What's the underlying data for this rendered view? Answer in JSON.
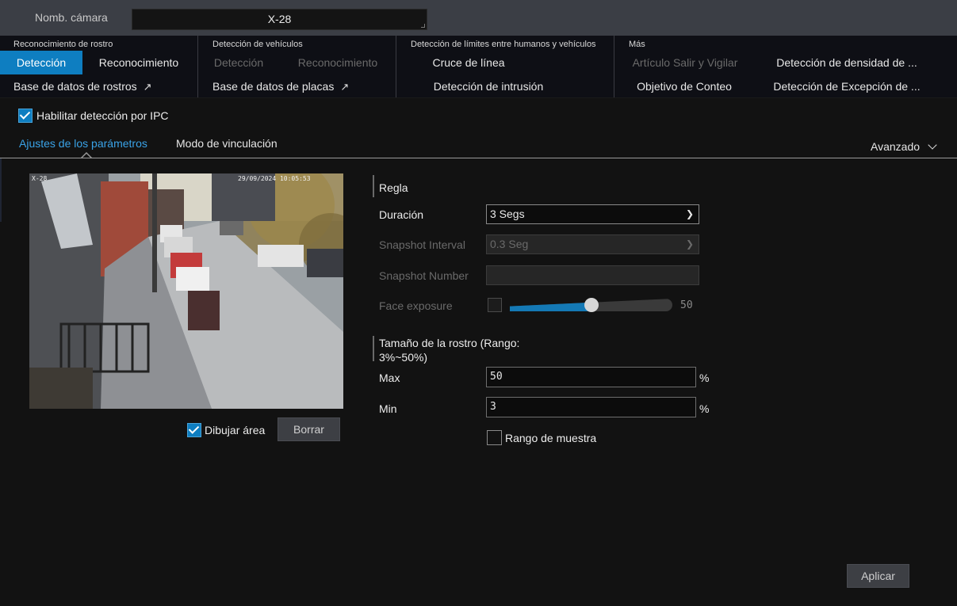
{
  "camera": {
    "label": "Nomb. cámara",
    "value": "X-28"
  },
  "categories": [
    {
      "heading": "Reconocimiento de rostro",
      "row1": [
        "Detección",
        "Reconocimiento"
      ],
      "row2": "Base de datos de rostros"
    },
    {
      "heading": "Detección de vehículos",
      "row1": [
        "Detección",
        "Reconocimiento"
      ],
      "row2": "Base de datos de placas"
    },
    {
      "heading": "Detección de límites entre humanos y vehículos",
      "row1": "Cruce de línea",
      "row2": "Detección de intrusión"
    },
    {
      "heading": "Más",
      "row1": [
        "Artículo Salir y Vigilar",
        "Detección de densidad de ..."
      ],
      "row2": [
        "Objetivo de Conteo",
        "Detección de Excepción de ..."
      ]
    }
  ],
  "enable_ipc": "Habilitar detección por IPC",
  "tabs": [
    "Ajustes de los parámetros",
    "Modo de vinculación"
  ],
  "advanced": "Avanzado",
  "video": {
    "osd_name": "X-28",
    "osd_time": "29/09/2024 10:05:53"
  },
  "draw_area": "Dibujar área",
  "clear_button": "Borrar",
  "rule": {
    "title": "Regla",
    "duration_label": "Duración",
    "duration_value": "3 Segs",
    "snapshot_interval_label": "Snapshot Interval",
    "snapshot_interval_value": "0.3 Seg",
    "snapshot_number_label": "Snapshot Number",
    "face_exposure_label": "Face exposure",
    "face_exposure_value": "50",
    "face_exposure_level_pct": 50
  },
  "face_size": {
    "title_line1": "Tamaño de la rostro (Rango:",
    "title_line2": "3%~50%)",
    "max_label": "Max",
    "max_value": "50",
    "min_label": "Min",
    "min_value": "3",
    "unit": "%",
    "sample_range": "Rango de muestra"
  },
  "apply_button": "Aplicar",
  "colors": {
    "accent": "#0e7ec1",
    "tab_active": "#3aa3e8",
    "background": "#121212"
  }
}
